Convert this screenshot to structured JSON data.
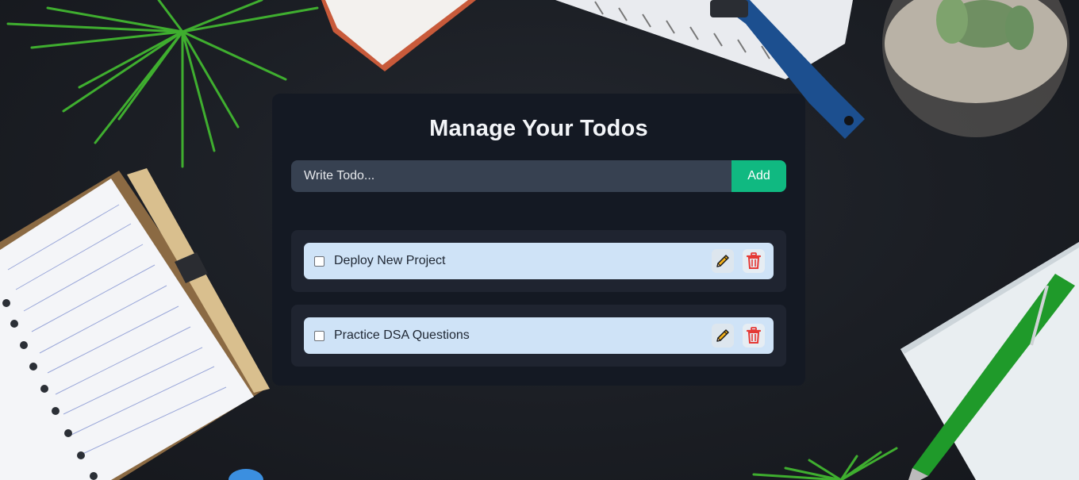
{
  "app": {
    "title": "Manage Your Todos"
  },
  "form": {
    "placeholder": "Write Todo...",
    "value": "",
    "add_label": "Add"
  },
  "todos": [
    {
      "text": "Deploy New Project",
      "completed": false
    },
    {
      "text": "Practice DSA Questions",
      "completed": false
    }
  ],
  "icons": {
    "edit": "pencil-icon",
    "delete": "trash-icon"
  },
  "colors": {
    "card": "#141923",
    "input": "#374151",
    "accent": "#10b981",
    "item": "#cfe3f7",
    "delete": "#e53935"
  }
}
